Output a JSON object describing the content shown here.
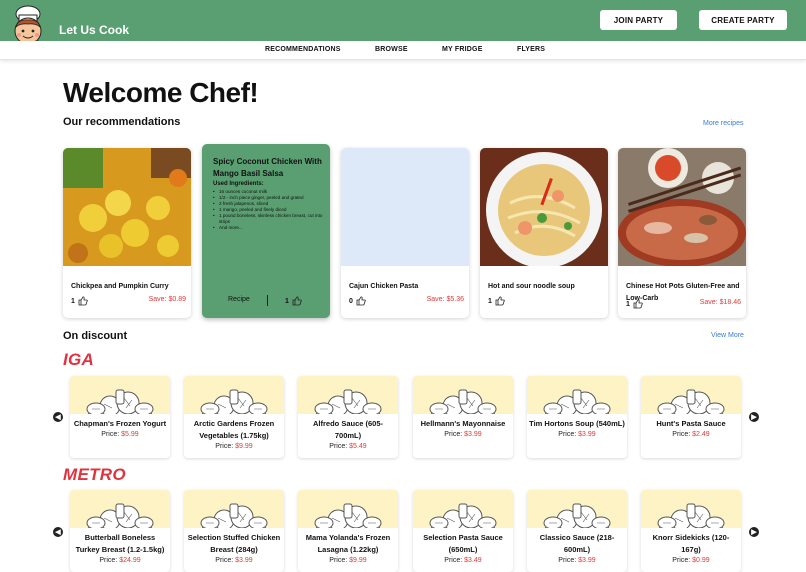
{
  "header": {
    "brand": "Let Us Cook",
    "join_party": "JOIN PARTY",
    "create_party": "CREATE PARTY"
  },
  "nav": [
    "RECOMMENDATIONS",
    "BROWSE",
    "MY FRIDGE",
    "FLYERS"
  ],
  "main": {
    "greeting": "Welcome Chef!",
    "recommendations_title": "Our recommendations",
    "more_recipes": "More recipes",
    "discount_title": "On discount",
    "view_more": "View More"
  },
  "recommendations": [
    {
      "title": "Chickpea and Pumpkin Curry",
      "likes": "1",
      "save": "Save:  $0.89"
    },
    {
      "title": "Cajun Chicken Pasta",
      "likes": "0",
      "save": "Save:  $5.36"
    },
    {
      "title": "Hot and sour noodle soup",
      "likes": "1",
      "save": ""
    },
    {
      "title": "Chinese Hot Pots Gluten-Free and Low-Carb",
      "likes": "1",
      "save": "Save:  $18.46"
    }
  ],
  "featured": {
    "title": "Spicy Coconut Chicken With Mango Basil Salsa",
    "subtitle": "Used Ingredients:",
    "ingredients": [
      "16 ounces coconut milk",
      "1/2 - inch piece ginger, peeled and grated",
      "2 fresh jalapenos, sliced",
      "1 mango, peeled and finely diced",
      "1 pound boneless, skinless chicken breast, cut into strips",
      "And more..."
    ],
    "recipe_label": "Recipe",
    "likes": "1"
  },
  "stores": [
    {
      "name": "IGA",
      "products": [
        {
          "name": "Chapman's Frozen Yogurt",
          "price": "$5.99"
        },
        {
          "name": "Arctic Gardens Frozen Vegetables (1.75kg)",
          "price": "$9.99"
        },
        {
          "name": "Alfredo Sauce (605-700mL)",
          "price": "$5.49"
        },
        {
          "name": "Hellmann's Mayonnaise",
          "price": "$3.99"
        },
        {
          "name": "Tim Hortons Soup (540mL)",
          "price": "$3.99"
        },
        {
          "name": "Hunt's Pasta Sauce",
          "price": "$2.49"
        }
      ]
    },
    {
      "name": "METRO",
      "products": [
        {
          "name": "Butterball Boneless Turkey Breast (1.2-1.5kg)",
          "price": "$24.99"
        },
        {
          "name": "Selection Stuffed Chicken Breast (284g)",
          "price": "$3.99"
        },
        {
          "name": "Mama Yolanda's Frozen Lasagna (1.22kg)",
          "price": "$9.99"
        },
        {
          "name": "Selection Pasta Sauce (650mL)",
          "price": "$3.49"
        },
        {
          "name": "Classico Sauce (218-600mL)",
          "price": "$3.99"
        },
        {
          "name": "Knorr Sidekicks (120-167g)",
          "price": "$0.99"
        }
      ]
    }
  ],
  "price_label": "Price:",
  "colors": {
    "brand_green": "#5a9f72",
    "sale_red": "#e03a3a",
    "store_red": "#e0333f",
    "link_blue": "#3a7bd5",
    "product_bg": "#fdf3c4"
  }
}
